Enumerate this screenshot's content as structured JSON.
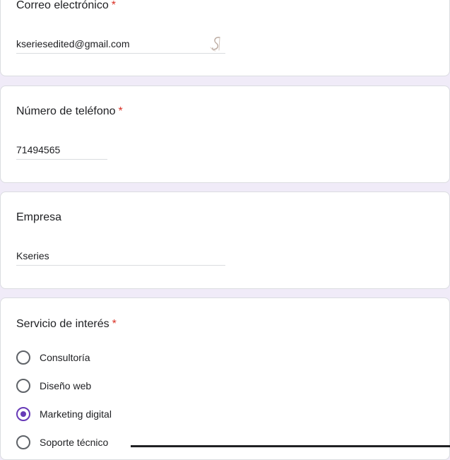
{
  "email": {
    "title": "Correo electrónico",
    "required_mark": "*",
    "value": "kseriesedited@gmail.com",
    "icon": "signature-icon"
  },
  "phone": {
    "title": "Número de teléfono",
    "required_mark": "*",
    "value": "71494565"
  },
  "company": {
    "title": "Empresa",
    "value": "Kseries"
  },
  "service": {
    "title": "Servicio de interés",
    "required_mark": "*",
    "options": [
      {
        "label": "Consultoría",
        "selected": false
      },
      {
        "label": "Diseño web",
        "selected": false
      },
      {
        "label": "Marketing digital",
        "selected": true
      },
      {
        "label": "Soporte técnico",
        "selected": false
      }
    ]
  },
  "colors": {
    "accent": "#673ab7",
    "required": "#d93025",
    "page_background": "#f0ebf8"
  }
}
